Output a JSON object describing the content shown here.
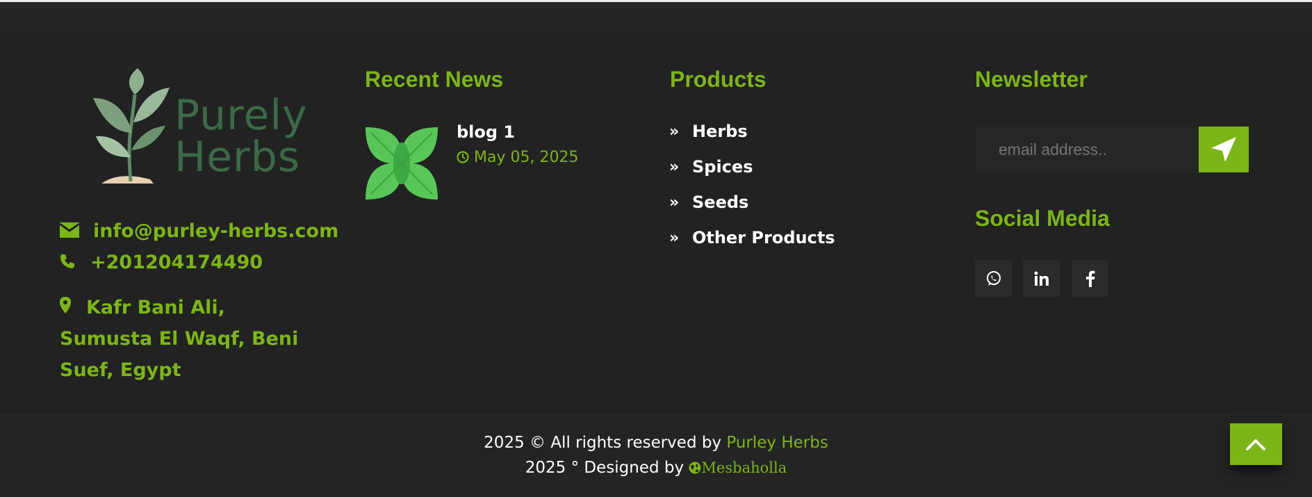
{
  "logo": {
    "line1": "Purely",
    "line2": "Herbs"
  },
  "contact": {
    "email": "info@purley-herbs.com",
    "phone": "+201204174490",
    "address": "Kafr Bani Ali, Sumusta El Waqf, Beni Suef, Egypt"
  },
  "recent_news": {
    "title": "Recent News",
    "items": [
      {
        "title": "blog 1",
        "date": "May 05, 2025"
      }
    ]
  },
  "products": {
    "title": "Products",
    "items": [
      "Herbs",
      "Spices",
      "Seeds",
      "Other Products"
    ]
  },
  "newsletter": {
    "title": "Newsletter",
    "placeholder": "email address..",
    "send_icon": "send-icon"
  },
  "social_media": {
    "title": "Social Media",
    "icons": [
      "whatsapp-icon",
      "linkedin-icon",
      "facebook-icon"
    ]
  },
  "copyright": {
    "prefix": "2025 © All rights reserved by",
    "brand": "Purley Herbs",
    "designed_prefix": "2025 ° Designed by",
    "designer": "Mesbaholla"
  },
  "colors": {
    "accent": "#7cb518",
    "background": "#222223",
    "logo_green": "#3b6a46"
  }
}
